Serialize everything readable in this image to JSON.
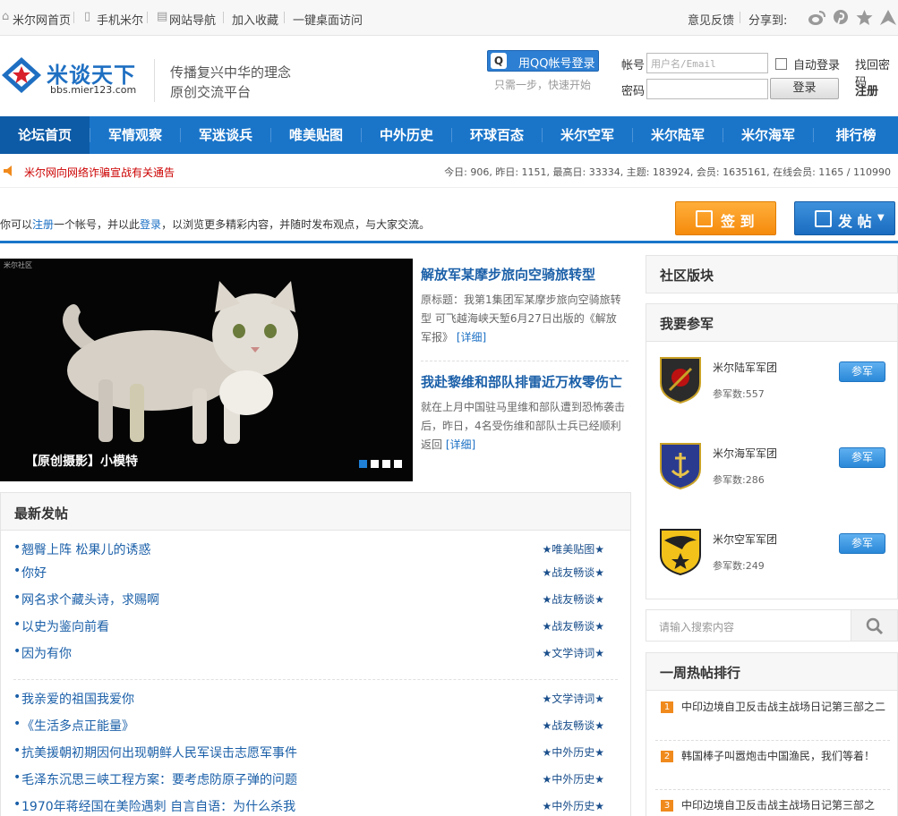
{
  "topbar": {
    "home": "米尔网首页",
    "mobile": "手机米尔",
    "nav": "网站导航",
    "fav": "加入收藏",
    "desktop": "一键桌面访问",
    "feedback": "意见反馈",
    "share": "分享到:"
  },
  "header": {
    "logo_title": "米谈天下",
    "logo_url": "bbs.mier123.com",
    "slogan1": "传播复兴中华的理念",
    "slogan2": "原创交流平台",
    "qq_login": "用QQ帐号登录",
    "qq_hint": "只需一步，快速开始",
    "account_label": "帐号",
    "account_placeholder": "用户名/Email",
    "password_label": "密码",
    "auto_login": "自动登录",
    "forgot": "找回密码",
    "login": "登录",
    "register": "注册"
  },
  "nav": {
    "items": [
      "论坛首页",
      "军情观察",
      "军迷谈兵",
      "唯美贴图",
      "中外历史",
      "环球百态",
      "米尔空军",
      "米尔陆军",
      "米尔海军",
      "排行榜"
    ]
  },
  "notice": {
    "message": "米尔网向网络诈骗宣战有关通告",
    "stats": "今日: 906, 昨日: 1151, 最高日: 33334, 主题: 183924, 会员: 1635161, 在线会员: 1165 / 110990"
  },
  "welcome": {
    "pre": "你可以",
    "register_link": "注册",
    "mid": "一个帐号，并以此",
    "login_link": "登录",
    "post": "，以浏览更多精彩内容，并随时发布观点，与大家交流。"
  },
  "actions": {
    "sign": "签 到",
    "post": "发 帖"
  },
  "slider": {
    "caption": "【原创摄影】小模特",
    "watermark": "米尔社区"
  },
  "news": [
    {
      "title": "解放军某摩步旅向空骑旅转型",
      "body": "原标题：我第1集团军某摩步旅向空骑旅转型 可飞越海峡天堑6月27日出版的《解放军报》",
      "more": "[详细]"
    },
    {
      "title": "我赴黎维和部队排雷近万枚零伤亡",
      "body": "就在上月中国驻马里维和部队遭到恐怖袭击后，昨日，4名受伤维和部队士兵已经顺利返回",
      "more": "[详细]"
    }
  ],
  "latest": {
    "title": "最新发帖",
    "rows": [
      {
        "title": "翘臀上阵 松果儿的诱惑",
        "cat": "★唯美贴图★"
      },
      {
        "title": "你好",
        "cat": "★战友畅谈★"
      },
      {
        "title": "网名求个藏头诗，求赐啊",
        "cat": "★战友畅谈★"
      },
      {
        "title": "以史为鉴向前看",
        "cat": "★战友畅谈★"
      },
      {
        "title": "因为有你",
        "cat": "★文学诗词★"
      },
      {
        "title": "我亲爱的祖国我爱你",
        "cat": "★文学诗词★"
      },
      {
        "title": "《生活多点正能量》",
        "cat": "★战友畅谈★"
      },
      {
        "title": "抗美援朝初期因何出现朝鲜人民军误击志愿军事件",
        "cat": "★中外历史★"
      },
      {
        "title": "毛泽东沉思三峡工程方案：要考虑防原子弹的问题",
        "cat": "★中外历史★"
      },
      {
        "title": "1970年蒋经国在美险遇刺 自言自语：为什么杀我",
        "cat": "★中外历史★"
      }
    ]
  },
  "sidebar": {
    "community": "社区版块",
    "join_title": "我要参军",
    "armies": [
      {
        "name": "米尔陆军军团",
        "count": "参军数:557",
        "btn": "参军"
      },
      {
        "name": "米尔海军军团",
        "count": "参军数:286",
        "btn": "参军"
      },
      {
        "name": "米尔空军军团",
        "count": "参军数:249",
        "btn": "参军"
      }
    ],
    "search_placeholder": "请输入搜索内容",
    "hot_title": "一周热帖排行",
    "hot": [
      {
        "n": "1",
        "title": "中印边境自卫反击战主战场日记第三部之二"
      },
      {
        "n": "2",
        "title": "韩国棒子叫嚣炮击中国渔民，我们等着！"
      },
      {
        "n": "3",
        "title": "中印边境自卫反击战主战场日记第三部之"
      }
    ]
  },
  "colors": {
    "brand": "#1a75c9",
    "accent": "#f58b0c",
    "link": "#1a5fa8",
    "notice": "#cc0000"
  }
}
